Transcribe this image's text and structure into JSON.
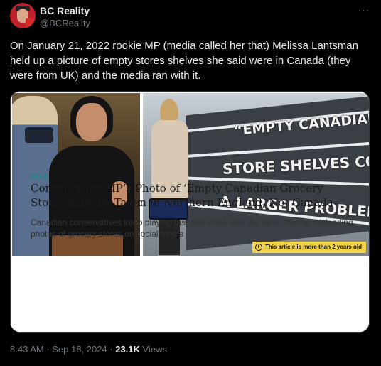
{
  "author": {
    "name": "BC Reality",
    "handle": "@BCReality"
  },
  "more_icon": "more-horizontal-icon",
  "tweet": {
    "text": "On January 21, 2022 rookie MP (media called her that) Melissa Lantsman held up a picture of empty stores shelves she said were in Canada (they were from UK) and the media ran with it."
  },
  "card": {
    "image_overlay": {
      "line1": "“EMPTY CANADIAN GROCERY",
      "line2": "STORE SHELVES COULD BECOME",
      "line3": "A LARGER PROBLEM.”"
    },
    "notice": "This article is more than 2 years old",
    "tag": "NEWS",
    "title": "Conservative MP’s Photo of ‘Empty Canadian Grocery Store’ Actually Taken in Northern England, Not Canada",
    "description": "Canadian conservatives keep playing fast and loose with the facts sharing misleading photos of grocery stores on social media"
  },
  "meta": {
    "time": "8:43 AM",
    "date": "Sep 18, 2024",
    "views_count": "23.1K",
    "views_label": "Views"
  },
  "colors": {
    "background": "#000000",
    "text": "#e7e9ea",
    "muted": "#71767b",
    "tag": "#1a8a7a",
    "notice": "#f1d44a"
  }
}
